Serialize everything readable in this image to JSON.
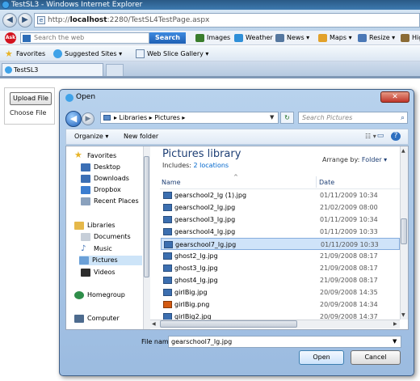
{
  "browser": {
    "window_title": "TestSL3 - Windows Internet Explorer",
    "url_prefix": "http://",
    "url_host": "localhost",
    "url_rest": ":2280/TestSL4TestPage.aspx",
    "back_glyph": "◀",
    "forward_glyph": "▶"
  },
  "ask_toolbar": {
    "logo": "Ask",
    "search_placeholder": "Search the web",
    "search_button": "Search",
    "items": [
      "Images",
      "Weather",
      "News ▾",
      "Maps ▾",
      "Resize ▾",
      "Hig"
    ],
    "item_colors": [
      "#3a7d2c",
      "#2f8fd8",
      "#55779f",
      "#e2a12a",
      "#4b78b6",
      "#8b6b35"
    ]
  },
  "favorites_bar": {
    "favorites": "Favorites",
    "suggested_sites": "Suggested Sites ▾",
    "web_slice_gallery": "Web Slice Gallery ▾"
  },
  "tabs": {
    "active_tab": "TestSL3"
  },
  "page": {
    "upload_button": "Upload File",
    "choose_file": "Choose File"
  },
  "dialog": {
    "title": "Open",
    "close_glyph": "✕",
    "breadcrumb": "▸ Libraries ▸ Pictures ▸",
    "search_placeholder": "Search Pictures",
    "search_icon": "⌕",
    "toolbar": {
      "organize": "Organize ▾",
      "new_folder": "New folder",
      "view_glyph": "☷ ▾",
      "preview_glyph": "▭",
      "help_glyph": "?"
    },
    "nav": [
      {
        "label": "Favorites",
        "icon": "star-icon",
        "color": "#e8b428"
      },
      {
        "label": "Desktop",
        "icon": "desktop-icon",
        "color": "#3b6fb5"
      },
      {
        "label": "Downloads",
        "icon": "downloads-icon",
        "color": "#3b6fb5"
      },
      {
        "label": "Dropbox",
        "icon": "dropbox-icon",
        "color": "#3b7dd0"
      },
      {
        "label": "Recent Places",
        "icon": "recent-places-icon",
        "color": "#8aa1bd"
      },
      {
        "label": "Libraries",
        "icon": "libraries-icon",
        "color": "#e5b84a"
      },
      {
        "label": "Documents",
        "icon": "documents-icon",
        "color": "#c7cfd9"
      },
      {
        "label": "Music",
        "icon": "music-icon",
        "color": "#3b6fb5"
      },
      {
        "label": "Pictures",
        "icon": "pictures-icon",
        "color": "#6aa0d8"
      },
      {
        "label": "Videos",
        "icon": "videos-icon",
        "color": "#2d2d2d"
      },
      {
        "label": "Homegroup",
        "icon": "homegroup-icon",
        "color": "#2f8e4a"
      },
      {
        "label": "Computer",
        "icon": "computer-icon",
        "color": "#4d6b8e"
      }
    ],
    "library_title": "Pictures library",
    "includes_label": "Includes:",
    "includes_link": "2 locations",
    "arrange_label": "Arrange by:",
    "arrange_value": "Folder ▾",
    "columns": {
      "name": "Name",
      "date": "Date"
    },
    "files": [
      {
        "name": "gearschool2_lg (1).jpg",
        "date": "01/11/2009 10:34",
        "type": "jpg"
      },
      {
        "name": "gearschool2_lg.jpg",
        "date": "21/02/2009 08:00",
        "type": "jpg"
      },
      {
        "name": "gearschool3_lg.jpg",
        "date": "01/11/2009 10:34",
        "type": "jpg"
      },
      {
        "name": "gearschool4_lg.jpg",
        "date": "01/11/2009 10:33",
        "type": "jpg"
      },
      {
        "name": "gearschool7_lg.jpg",
        "date": "01/11/2009 10:33",
        "type": "jpg",
        "selected": true
      },
      {
        "name": "ghost2_lg.jpg",
        "date": "21/09/2008 08:17",
        "type": "jpg"
      },
      {
        "name": "ghost3_lg.jpg",
        "date": "21/09/2008 08:17",
        "type": "jpg"
      },
      {
        "name": "ghost4_lg.jpg",
        "date": "21/09/2008 08:17",
        "type": "jpg"
      },
      {
        "name": "girlBig.jpg",
        "date": "20/09/2008 14:35",
        "type": "jpg"
      },
      {
        "name": "girlBig.png",
        "date": "20/09/2008 14:34",
        "type": "png"
      },
      {
        "name": "girlBig2.jpg",
        "date": "20/09/2008 14:37",
        "type": "jpg"
      }
    ],
    "filename_label": "File name:",
    "filename_value": "gearschool7_lg.jpg",
    "open_button": "Open",
    "cancel_button": "Cancel"
  }
}
